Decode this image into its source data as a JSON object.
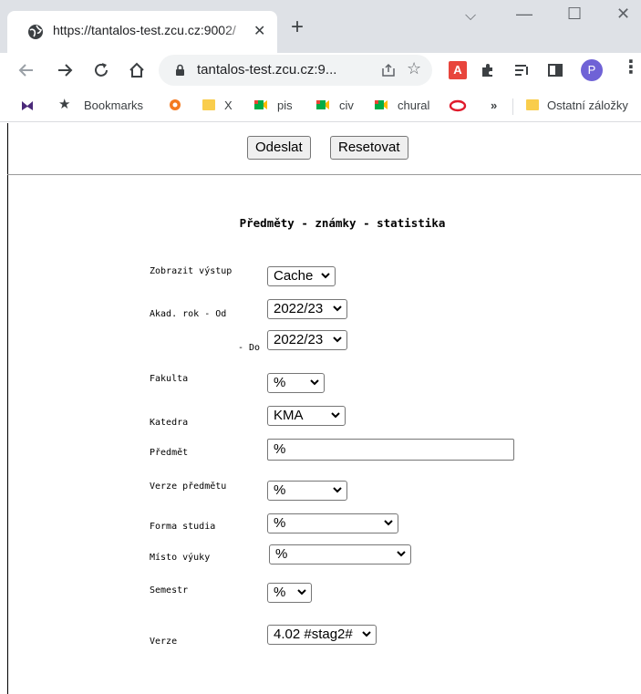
{
  "browser": {
    "tab_title": "https://tantalos-test.zcu.cz:9002/",
    "tab_close": "✕",
    "new_tab": "+",
    "window_controls": {
      "minimize": "—",
      "maximize": "☐",
      "close": "✕",
      "dropdown": "⌵"
    },
    "url": "tantalos-test.zcu.cz:9...",
    "profile_initial": "P",
    "bookmarks": {
      "bookmarks_label": "Bookmarks",
      "items": [
        "X",
        "pis",
        "civ",
        "chural"
      ],
      "more": "»",
      "other": "Ostatní záložky"
    },
    "icons": {
      "back": "back-arrow-icon",
      "forward": "forward-arrow-icon",
      "reload": "reload-icon",
      "home": "home-icon",
      "lock": "lock-icon",
      "share": "share-icon",
      "star": "star-icon"
    }
  },
  "toolbar": {
    "submit_label": "Odeslat",
    "reset_label": "Resetovat"
  },
  "form": {
    "heading": "Předměty - známky - statistika",
    "output_label": "Zobrazit výstup",
    "output_value": "Cache",
    "year_from_label": "Akad. rok - Od",
    "year_from_value": "2022/23",
    "year_to_label": "- Do",
    "year_to_value": "2022/23",
    "faculty_label": "Fakulta",
    "faculty_value": "%",
    "department_label": "Katedra",
    "department_value": "KMA",
    "subject_label": "Předmět",
    "subject_value": "%",
    "subject_version_label": "Verze předmětu",
    "subject_version_value": "%",
    "study_form_label": "Forma studia",
    "study_form_value": "%",
    "place_label": "Místo výuky",
    "place_value": "%",
    "semester_label": "Semestr",
    "semester_value": "%",
    "version_label": "Verze",
    "version_value": "4.02 #stag2#"
  },
  "colors": {
    "tabstrip": "#dee1e6",
    "omnibox": "#f1f3f4",
    "avatar": "#6f62d6"
  }
}
